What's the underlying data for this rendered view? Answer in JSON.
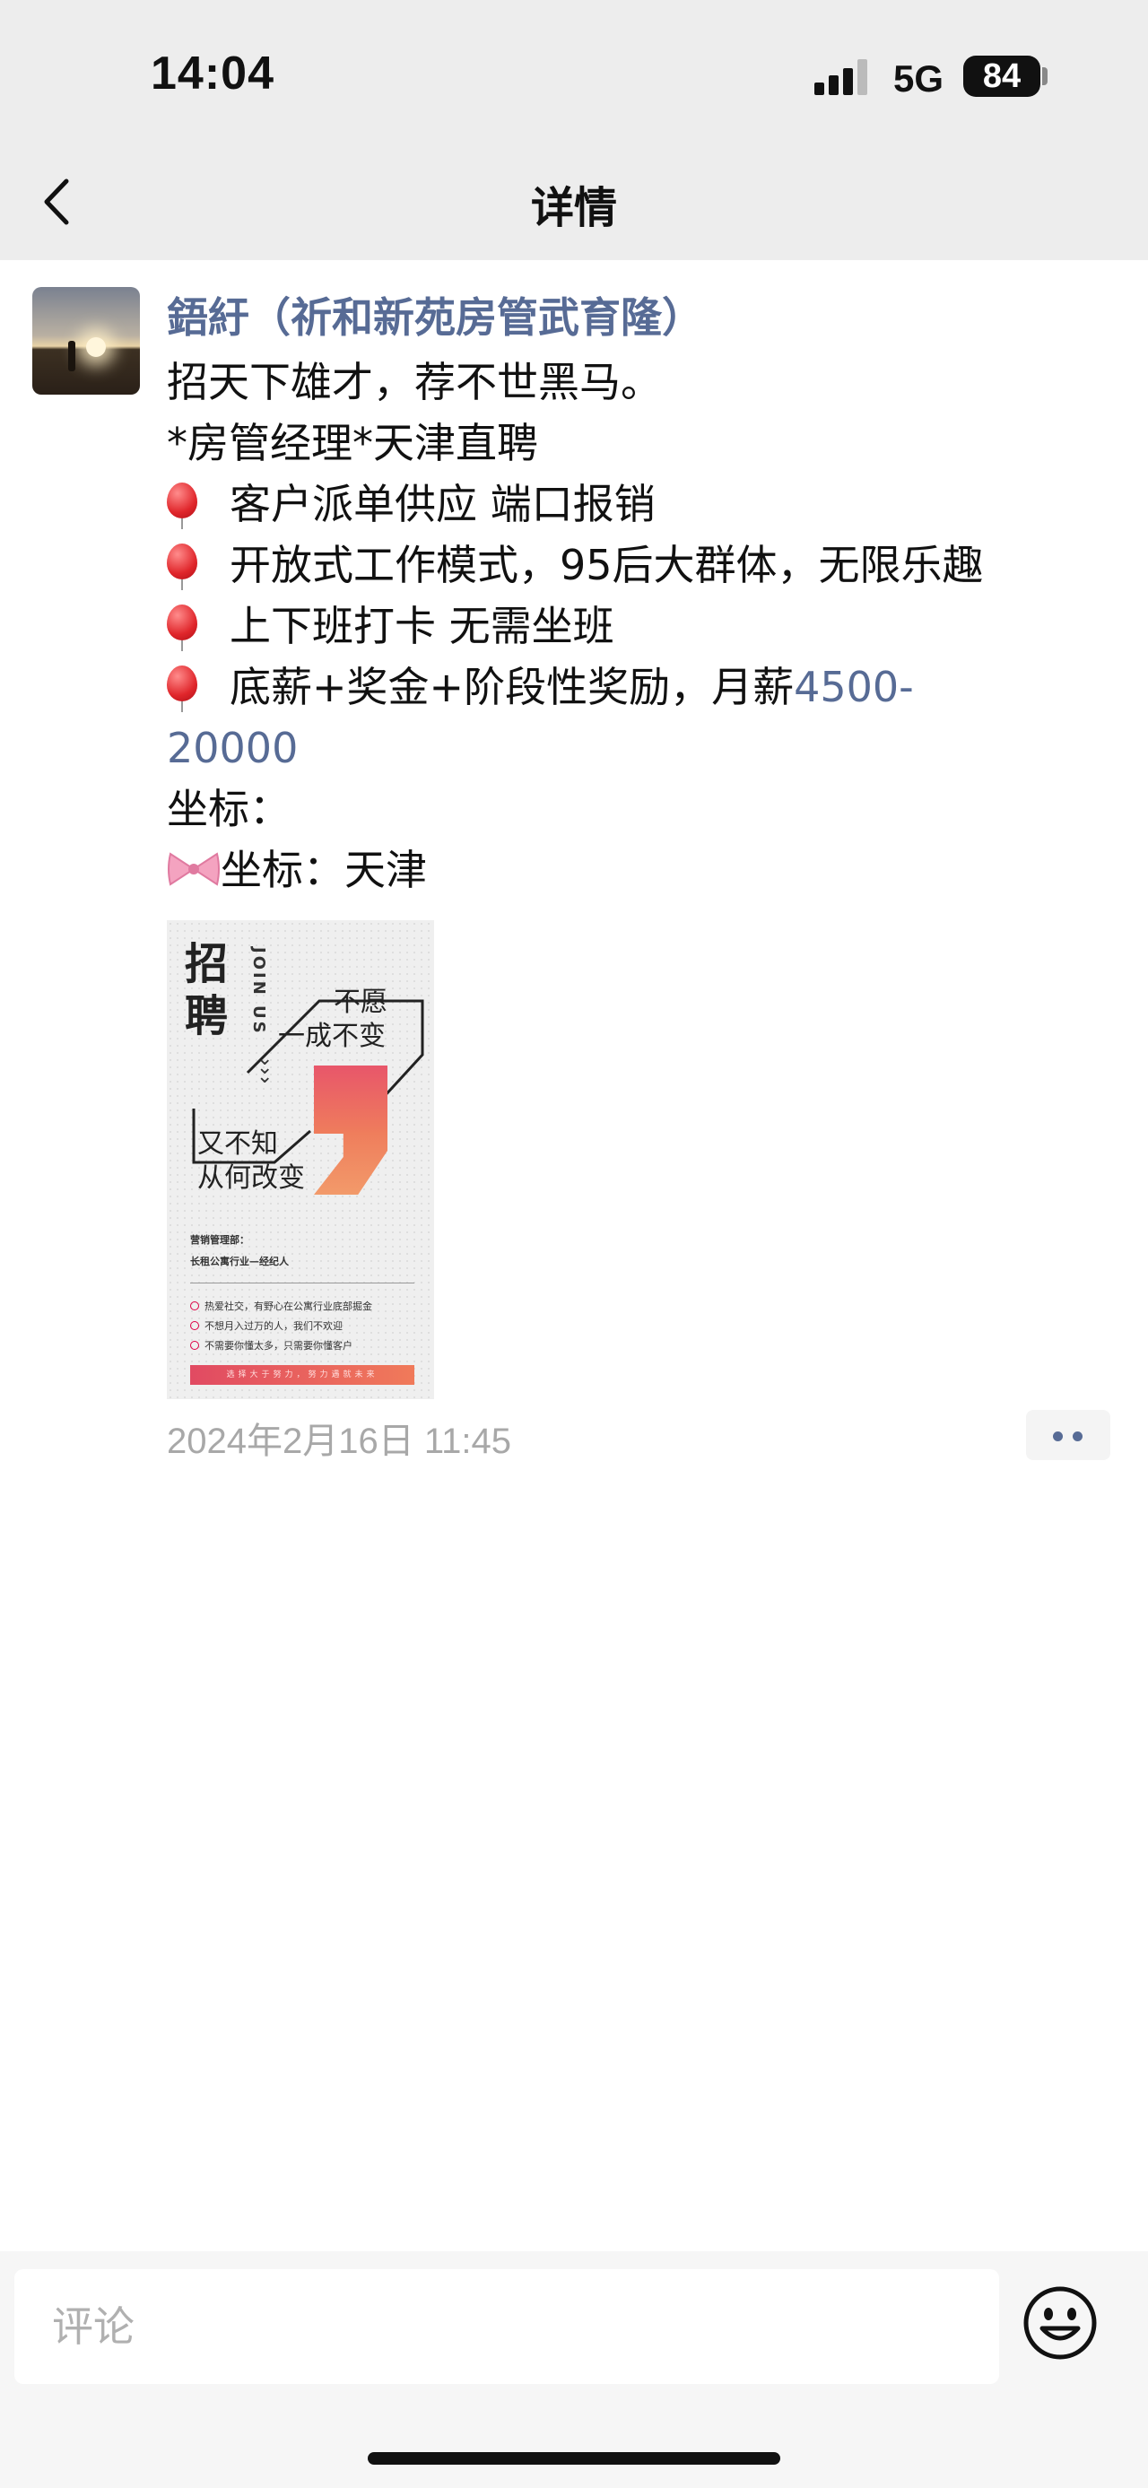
{
  "status_bar": {
    "time": "14:04",
    "network": "5G",
    "battery": "84"
  },
  "nav": {
    "title": "详情"
  },
  "post": {
    "author": "鋙紆（祈和新苑房管武育隆）",
    "lines": {
      "l1": "招天下雄才，荐不世黑马。",
      "l2": "*房管经理*天津直聘",
      "l3": "客户派单供应 端口报销",
      "l4": "开放式工作模式，95后大群体，无限乐趣",
      "l5": "上下班打卡 无需坐班",
      "l6_prefix": "底薪+奖金+阶段性奖励，月薪",
      "l6_link": "4500-",
      "l7_link": "20000",
      "l8": "坐标：",
      "l9": "坐标：天津"
    },
    "poster": {
      "big": "招聘",
      "join": "JOIN US",
      "t1": "不愿",
      "t2": "一成不变",
      "t3": "又不知",
      "t4": "从何改变",
      "dept": "营销管理部：",
      "role": "长租公寓行业—经纪人",
      "b1": "热爱社交，有野心在公寓行业底部掘金",
      "b2": "不想月入过万的人，我们不欢迎",
      "b3": "不需要你懂太多，只需要你懂客户",
      "footer": "选择大于努力，努力遇就未来"
    },
    "timestamp": "2024年2月16日 11:45"
  },
  "comment_bar": {
    "placeholder": "评论"
  },
  "colors": {
    "link": "#576b95",
    "background": "#ededed",
    "accent": "#e14a62"
  },
  "icons": [
    "back-arrow-icon",
    "signal-icon",
    "balloon-icon",
    "bow-icon",
    "more-dots-icon",
    "emoji-icon"
  ]
}
